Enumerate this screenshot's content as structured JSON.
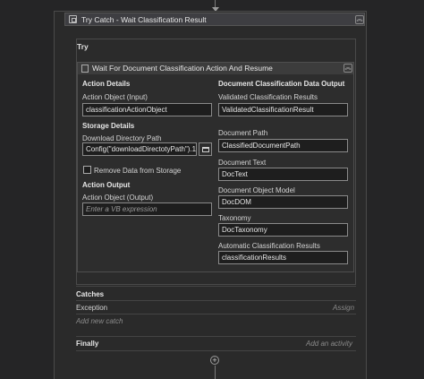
{
  "try_catch": {
    "title": "Try Catch - Wait Classification Result",
    "collapse_icon": "double-chevron-up-icon",
    "try_label": "Try"
  },
  "activity": {
    "title": "Wait For Document Classification Action And Resume",
    "action_details": {
      "title": "Action Details",
      "action_object_input_label": "Action Object (Input)",
      "action_object_input_value": "classificationActionObject"
    },
    "storage_details": {
      "title": "Storage Details",
      "download_dir_label": "Download Directory Path",
      "download_dir_value": "Config(\"downloadDirectotyPath\").1",
      "remove_data_label": "Remove Data from Storage",
      "remove_data_checked": false
    },
    "action_output": {
      "title": "Action Output",
      "action_object_output_label": "Action Object (Output)",
      "action_object_output_placeholder": "Enter a VB expression"
    },
    "doc_class_output": {
      "title": "Document Classification Data Output",
      "validated_label": "Validated Classification Results",
      "validated_value": "ValidatedClassificationResult",
      "doc_path_label": "Document Path",
      "doc_path_value": "ClassifiedDocumentPath",
      "doc_text_label": "Document Text",
      "doc_text_value": "DocText",
      "dom_label": "Document Object Model",
      "dom_value": "DocDOM",
      "taxonomy_label": "Taxonomy",
      "taxonomy_value": "DocTaxonomy",
      "auto_results_label": "Automatic Classification Results",
      "auto_results_value": "classificationResults"
    }
  },
  "catches": {
    "title": "Catches",
    "exception_label": "Exception",
    "assign_hint": "Assign",
    "add_new_catch": "Add new catch"
  },
  "finally": {
    "title": "Finally",
    "add_activity_hint": "Add an activity"
  }
}
